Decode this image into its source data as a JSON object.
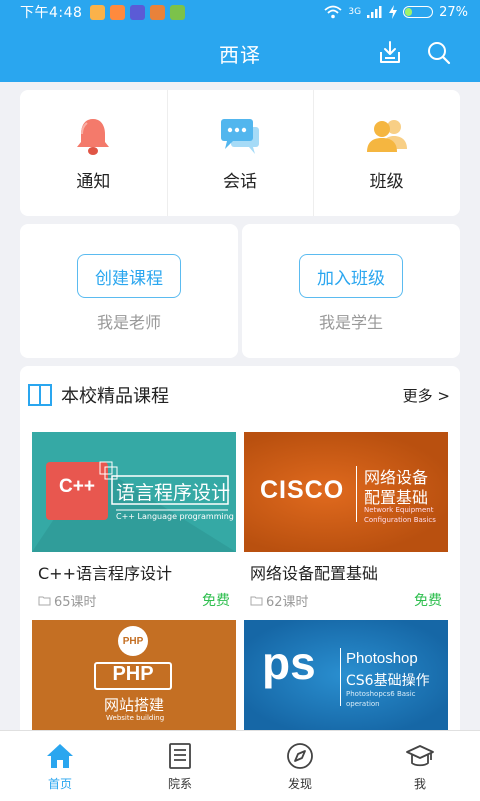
{
  "status_bar": {
    "time": "下午4:48",
    "network": "3G",
    "battery": "27%",
    "battery_level": 0.27
  },
  "header": {
    "title": "西译",
    "download_icon": "download-icon",
    "search_icon": "search-icon"
  },
  "quick_actions": [
    {
      "label": "通知",
      "icon": "bell-icon",
      "color": "#f26b5b"
    },
    {
      "label": "会话",
      "icon": "chat-icon",
      "color": "#52b6ee"
    },
    {
      "label": "班级",
      "icon": "people-icon",
      "color": "#f5b640"
    }
  ],
  "roles": {
    "teacher": {
      "button": "创建课程",
      "caption": "我是老师"
    },
    "student": {
      "button": "加入班级",
      "caption": "我是学生"
    }
  },
  "courses_section": {
    "title": "本校精品课程",
    "more": "更多 >",
    "items": [
      {
        "title": "C++语言程序设计",
        "lessons": "65课时",
        "price": "免费",
        "thumb": {
          "badge": "C++",
          "heading": "语言程序设计",
          "sub": "C++ Language programming"
        }
      },
      {
        "title": "网络设备配置基础",
        "lessons": "62课时",
        "price": "免费",
        "thumb": {
          "badge": "CISCO",
          "heading_line1": "网络设备",
          "heading_line2": "配置基础",
          "sub_line1": "Network Equipment",
          "sub_line2": "Configuration Basics"
        }
      },
      {
        "thumb": {
          "circle": "PHP",
          "badge": "PHP",
          "heading": "网站搭建",
          "sub": "Website building"
        }
      },
      {
        "thumb": {
          "badge": "ps",
          "heading_line1": "Photoshop",
          "heading_line2": "CS6基础操作",
          "sub_line1": "Photoshopcs6 Basic",
          "sub_line2": "operation"
        }
      }
    ]
  },
  "bottom_nav": [
    {
      "label": "首页",
      "icon": "home-icon",
      "active": true
    },
    {
      "label": "院系",
      "icon": "list-icon",
      "active": false
    },
    {
      "label": "发现",
      "icon": "compass-icon",
      "active": false
    },
    {
      "label": "我",
      "icon": "graduation-cap-icon",
      "active": false
    }
  ],
  "colors": {
    "primary": "#2aa6ef",
    "free": "#2fbf4f",
    "background": "#f0f1f5"
  }
}
